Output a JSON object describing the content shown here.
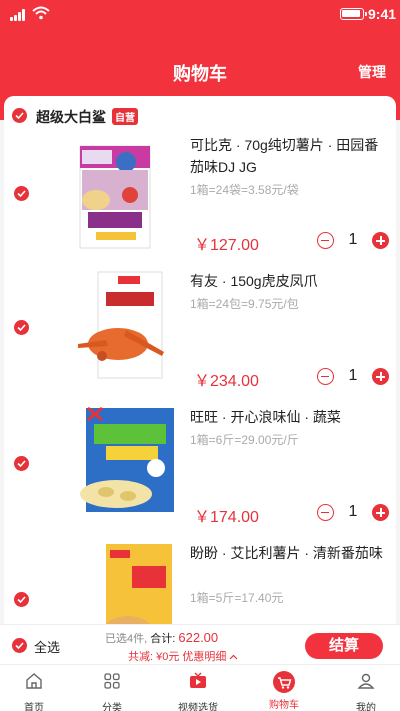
{
  "status": {
    "time": "9:41"
  },
  "header": {
    "title": "购物车",
    "manage": "管理"
  },
  "store": {
    "name": "超级大白鲨",
    "badge": "自营"
  },
  "items": [
    {
      "title": "可比克 · 70g纯切薯片 · 田园番茄味DJ JG",
      "spec": "1箱=24袋=3.58元/袋",
      "price": "￥127.00",
      "qty": "1"
    },
    {
      "title": "有友 · 150g虎皮凤爪",
      "spec": "1箱=24包=9.75元/包",
      "price": "￥234.00",
      "qty": "1"
    },
    {
      "title": "旺旺 · 开心浪味仙 · 蔬菜",
      "spec": "1箱=6斤=29.00元/斤",
      "price": "￥174.00",
      "qty": "1"
    },
    {
      "title": "盼盼 · 艾比利薯片 · 清新番茄味",
      "spec": "1箱=5斤=17.40元",
      "price": "",
      "qty": ""
    }
  ],
  "checkout": {
    "select_all": "全选",
    "selected": "已选4件,",
    "total_label": "合计:",
    "total": "622.00",
    "discount": "共减: ¥0元",
    "detail": "优惠明细",
    "pay": "结算"
  },
  "tabs": [
    {
      "label": "首页",
      "icon": "home-icon"
    },
    {
      "label": "分类",
      "icon": "category-icon"
    },
    {
      "label": "视频选货",
      "icon": "video-icon"
    },
    {
      "label": "购物车",
      "icon": "cart-icon",
      "active": true
    },
    {
      "label": "我的",
      "icon": "profile-icon"
    }
  ],
  "colors": {
    "accent": "#f2323c"
  }
}
